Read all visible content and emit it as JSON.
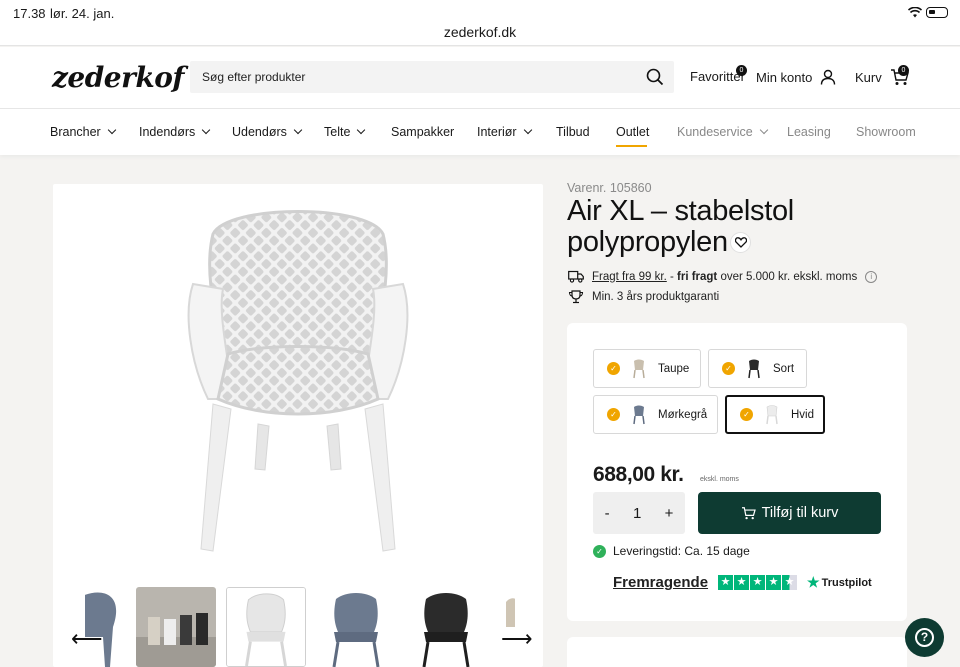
{
  "status": {
    "time": "17.38",
    "date": "lør. 24. jan."
  },
  "browser": {
    "url": "zederkof.dk"
  },
  "header": {
    "logo": "zederkof",
    "search_placeholder": "Søg efter produkter",
    "favorites_label": "Favoritter",
    "favorites_count": "0",
    "account_label": "Min konto",
    "cart_label": "Kurv",
    "cart_count": "0"
  },
  "nav": {
    "items": [
      {
        "label": "Brancher",
        "dropdown": true
      },
      {
        "label": "Indendørs",
        "dropdown": true
      },
      {
        "label": "Udendørs",
        "dropdown": true
      },
      {
        "label": "Telte",
        "dropdown": true
      },
      {
        "label": "Sampakker",
        "dropdown": false
      },
      {
        "label": "Interiør",
        "dropdown": true
      },
      {
        "label": "Tilbud",
        "dropdown": false
      },
      {
        "label": "Outlet",
        "dropdown": false,
        "active": true
      },
      {
        "label": "Kundeservice",
        "dropdown": true
      },
      {
        "label": "Leasing",
        "dropdown": false
      },
      {
        "label": "Showroom",
        "dropdown": false
      }
    ]
  },
  "product": {
    "sku": "Varenr. 105860",
    "title": "Air XL – stabelstol polypropylen",
    "shipping_link": "Fragt fra 99 kr.",
    "shipping_sep": " - ",
    "shipping_bold": "fri fragt",
    "shipping_rest": " over 5.000 kr. ekskl. moms",
    "guarantee": "Min. 3 års produktgaranti",
    "variants": [
      {
        "label": "Taupe",
        "selected": false
      },
      {
        "label": "Sort",
        "selected": false
      },
      {
        "label": "Mørkegrå",
        "selected": false
      },
      {
        "label": "Hvid",
        "selected": true
      }
    ],
    "price": "688,00 kr.",
    "price_note": "ekskl. moms",
    "quantity": "1",
    "qty_minus": "-",
    "qty_plus": "+",
    "add_to_cart": "Tilføj til kurv",
    "delivery": "Leveringstid: Ca. 15 dage",
    "rating_label": "Fremragende",
    "trustpilot": "Trustpilot"
  },
  "colors": {
    "brand_dark": "#0e3b32",
    "accent": "#f0a500",
    "trustpilot": "#00b67a"
  },
  "gallery": {
    "active_thumb": 2,
    "thumb_count": 6
  }
}
